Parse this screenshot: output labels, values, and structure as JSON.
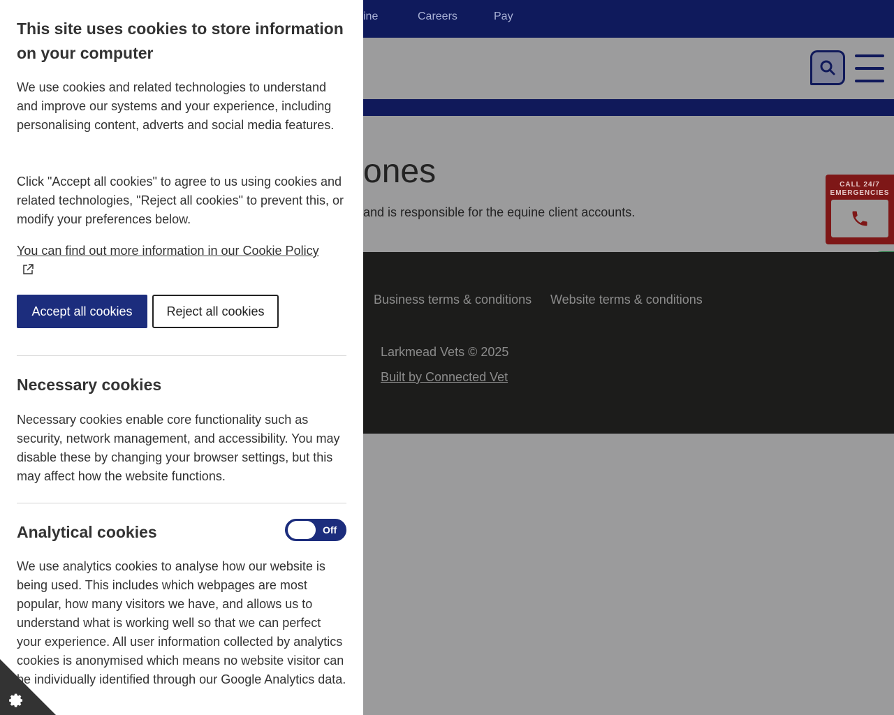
{
  "topnav": {
    "items": [
      "ine",
      "Careers",
      "Pay"
    ]
  },
  "page": {
    "heading": "ones",
    "subtext": "and is responsible for the equine client accounts."
  },
  "emergency": {
    "label": "CALL 24/7 EMERGENCIES"
  },
  "footer": {
    "links": [
      "Business terms & conditions",
      "Website terms & conditions"
    ],
    "copyright": "Larkmead Vets © 2025",
    "built_by": "Built by Connected Vet"
  },
  "cookie_panel": {
    "title": "This site uses cookies to store information on your computer",
    "intro": "We use cookies and related technologies to understand and improve our systems and your experience, including personalising content, adverts and social media features.",
    "instructions": "Click \"Accept all cookies\" to agree to us using cookies and related technologies, \"Reject all cookies\" to prevent this, or modify your preferences below.",
    "policy_link": "You can find out more information in our Cookie Policy",
    "accept_label": "Accept all cookies",
    "reject_label": "Reject all cookies",
    "necessary": {
      "title": "Necessary cookies",
      "text": "Necessary cookies enable core functionality such as security, network management, and accessibility. You may disable these by changing your browser settings, but this may affect how the website functions."
    },
    "analytical": {
      "title": "Analytical cookies",
      "toggle_state": "Off",
      "text": "We use analytics cookies to analyse how our website is being used. This includes which webpages are most popular, how many visitors we have, and allows us to understand what is working well so that we can perfect your experience. All user information collected by analytics cookies is anonymised which means no website visitor can be individually identified through our Google Analytics data."
    }
  },
  "colors": {
    "navy": "#0f1a5c",
    "button_blue": "#1c2d7d",
    "emergency_red": "#7e1717",
    "whatsapp_green": "#1e7c40",
    "overlay_grey": "#9b9b9c",
    "footer_dark": "#1c1c1b"
  }
}
